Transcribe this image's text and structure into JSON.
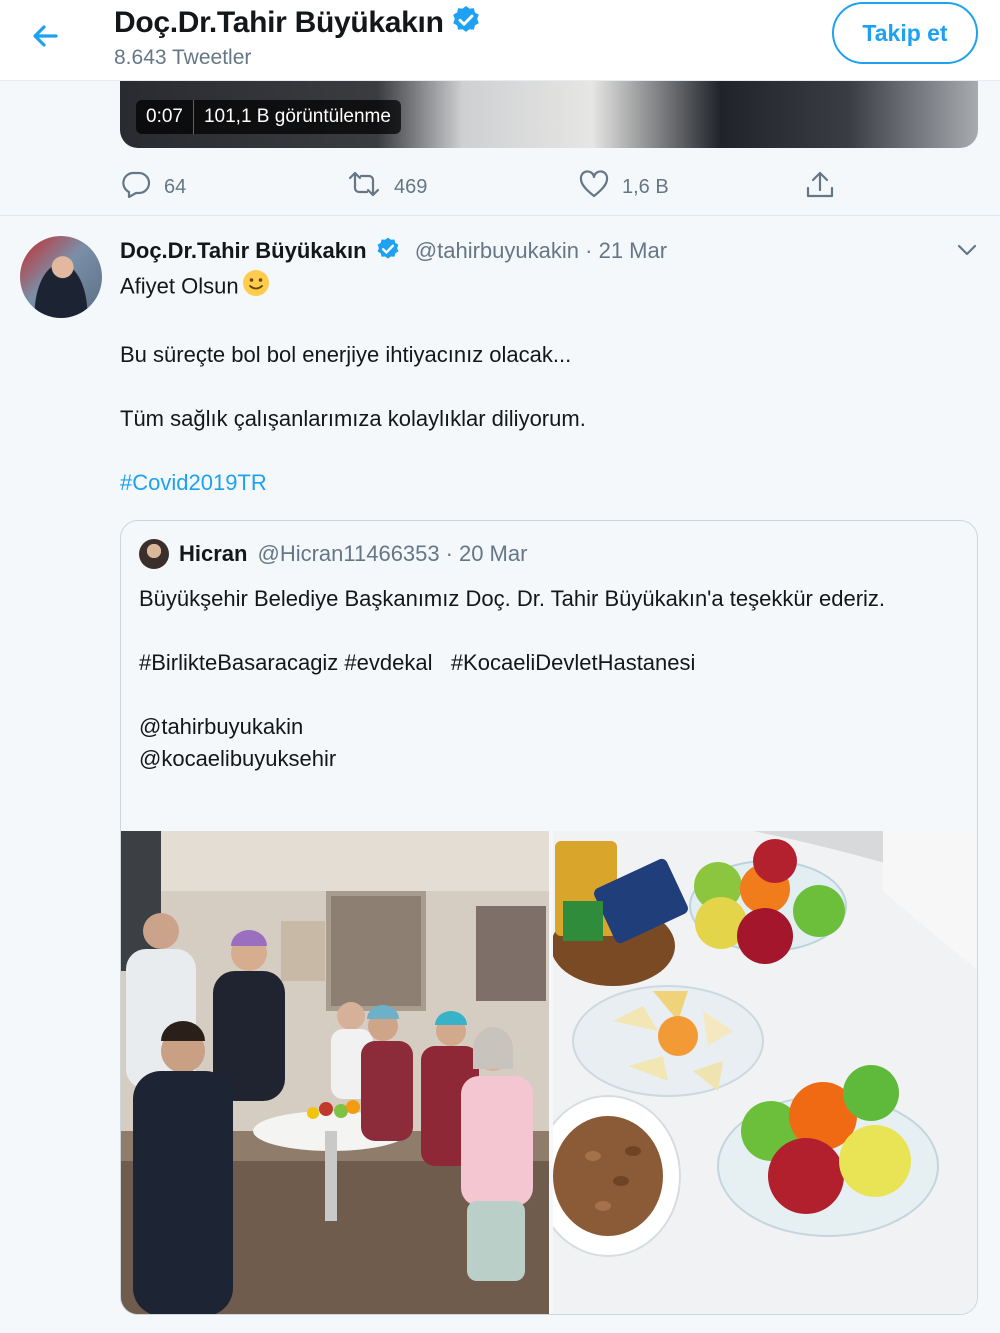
{
  "header": {
    "title": "Doç.Dr.Tahir Büyükakın",
    "tweet_count": "8.643 Tweetler",
    "follow_label": "Takip et"
  },
  "top_tweet": {
    "video_time": "0:07",
    "video_views": "101,1 B görüntülenme",
    "reply_count": "64",
    "retweet_count": "469",
    "like_count": "1,6 B"
  },
  "tweet": {
    "name": "Doç.Dr.Tahir Büyükakın",
    "handle": "@tahirbuyukakin",
    "separator": "·",
    "date": "21 Mar",
    "line1": "Afiyet Olsun",
    "line2": "Bu süreçte bol bol enerjiye ihtiyacınız olacak...",
    "line3": "Tüm sağlık çalışanlarımıza kolaylıklar diliyorum.",
    "hashtag": "#Covid2019TR"
  },
  "quote": {
    "name": "Hicran",
    "handle": "@Hicran11466353",
    "separator": "·",
    "date": "20 Mar",
    "text1": "Büyükşehir Belediye Başkanımız Doç. Dr. Tahir Büyükakın'a teşekkür ederiz.",
    "hashtags": "#BirlikteBasaracagiz #evdekal   #KocaeliDevletHastanesi",
    "mention1": "@tahirbuyukakin",
    "mention2": "@kocaelibuyuksehir"
  },
  "colors": {
    "accent": "#1da1f2",
    "secondary_text": "#657786",
    "background": "#f5f8fa"
  },
  "icons": [
    "back-arrow-icon",
    "verified-badge-icon",
    "reply-icon",
    "retweet-icon",
    "like-icon",
    "share-icon",
    "chevron-down-icon",
    "smiley-emoji-icon"
  ]
}
